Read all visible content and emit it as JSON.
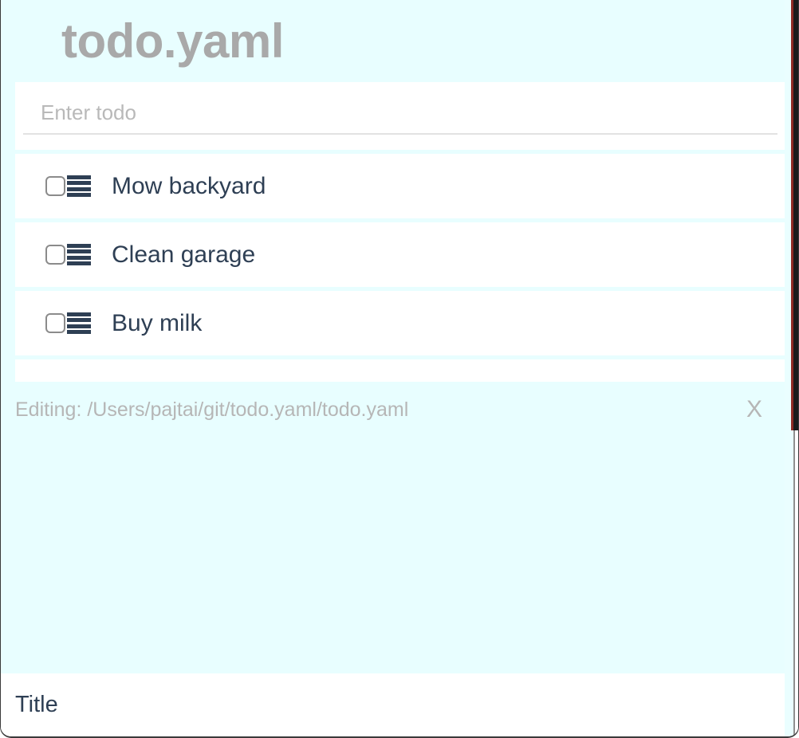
{
  "header": {
    "title": "todo.yaml"
  },
  "input": {
    "placeholder": "Enter todo",
    "value": ""
  },
  "todos": [
    {
      "label": "Mow backyard",
      "checked": false,
      "checkbox_name": "todo-checkbox",
      "handle_name": "drag-handle-icon"
    },
    {
      "label": "Clean garage",
      "checked": false,
      "checkbox_name": "todo-checkbox",
      "handle_name": "drag-handle-icon"
    },
    {
      "label": "Buy milk",
      "checked": false,
      "checkbox_name": "todo-checkbox",
      "handle_name": "drag-handle-icon"
    }
  ],
  "status": {
    "text": "Editing: /Users/pajtai/git/todo.yaml/todo.yaml",
    "close_label": "X",
    "close_icon": "close-x-icon"
  },
  "bottom_bar": {
    "title": "Title"
  },
  "colors": {
    "background": "#e8feff",
    "card": "#ffffff",
    "title_text": "#a9a9a9",
    "body_text": "#2e3f54",
    "muted_text": "#b6b6b6",
    "checkbox_border": "#8b8b8b",
    "input_underline": "#e2e2e2"
  }
}
